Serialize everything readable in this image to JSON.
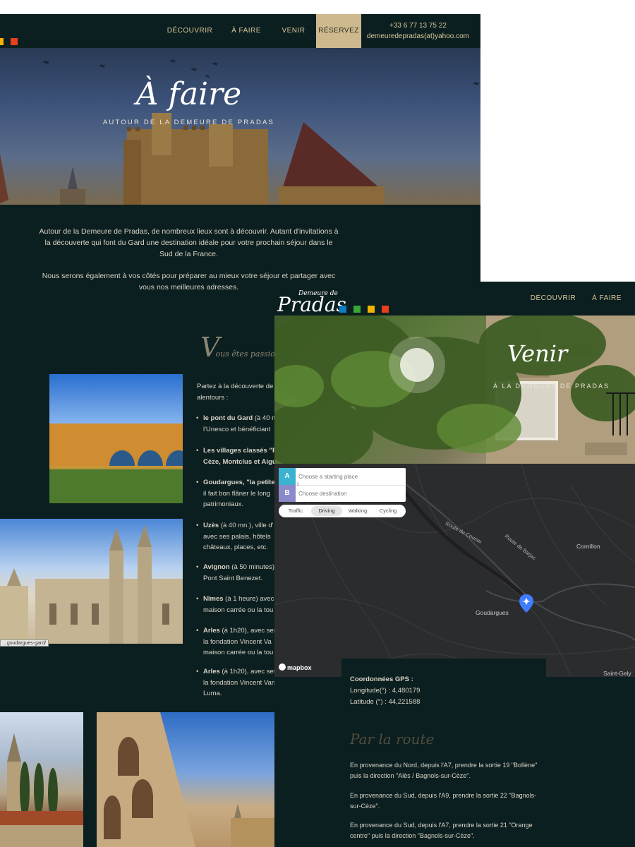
{
  "back_page": {
    "nav": {
      "items": [
        "DÉCOUVRIR",
        "À FAIRE",
        "VENIR",
        "RÉSERVEZ"
      ],
      "phone": "+33 6 77 13 75 22",
      "email": "demeuredepradas(at)yahoo.com"
    },
    "hero": {
      "title": "À faire",
      "subtitle": "AUTOUR DE LA DEMEURE DE PRADAS"
    },
    "intro": {
      "p1": "Autour de la Demeure de Pradas, de nombreux lieux sont à découvrir. Autant d'invitations à la découverte qui font du Gard une destination idéale pour votre prochain séjour dans le Sud de la France.",
      "p2": "Nous serons également à vos côtés pour préparer au mieux votre séjour et partager avec vous nos meilleures adresses."
    },
    "section_heading": {
      "initial": "V",
      "rest": "ous êtes passion"
    },
    "list_intro": "Partez à la découverte de\nalentours :",
    "list": [
      {
        "bold": "le pont du Gard",
        "text": " (à 40 m\nl'Unesco et bénéficiant"
      },
      {
        "bold": "Les villages classés \"Pl\nCèze, Montclus et Aigue",
        "text": ""
      },
      {
        "bold": "Goudargues, \"la petite",
        "text": "\nil fait bon flâner le long\npatrimoniaux."
      },
      {
        "bold": "Uzès",
        "text": " (à 40 mn.), ville d'\navec ses palais, hôtels\nchâteaux, places, etc."
      },
      {
        "bold": "Avignon",
        "text": " (à 50 minutes)\nPont Saint Benezet."
      },
      {
        "bold": "Nîmes",
        "text": " (à 1 heure) avec\nmaison carrée ou la tou"
      },
      {
        "bold": "Arles",
        "text": " (à 1h20), avec ses\nla fondation Vincent Va\nmaison carrée ou la tou"
      },
      {
        "bold": "Arles",
        "text": " (à 1h20), avec ses\nla fondation Vincent Van\nLuma."
      }
    ],
    "tooltip": "...goudargues-gard/",
    "accent_squares": [
      "#f2b200",
      "#e8401c"
    ]
  },
  "front_page": {
    "logo": {
      "small": "Demeure de",
      "big": "Pradas"
    },
    "logo_squares": [
      "#0e7cc2",
      "#35a83a",
      "#f2b200",
      "#e8401c"
    ],
    "nav": {
      "items": [
        "DÉCOUVRIR",
        "À FAIRE"
      ]
    },
    "hero": {
      "title": "Venir",
      "subtitle": "À LA DEMEURE DE PRADAS"
    },
    "map": {
      "start_label": "A",
      "start_placeholder": "Choose a starting place",
      "dest_label": "B",
      "dest_placeholder": "Choose destination",
      "modes": [
        "Traffic",
        "Driving",
        "Walking",
        "Cycling"
      ],
      "active_mode": "Driving",
      "places": {
        "goudargues": "Goudargues",
        "cornillon": "Cornillon",
        "saint_gely": "Saint-Gely"
      },
      "roads": {
        "courau": "Route du Courau",
        "barjac": "Route de Barjac"
      },
      "attribution": "mapbox",
      "badge_a_color": "#3bb2d0",
      "badge_b_color": "#8a8acb",
      "marker_color": "#3f7cff"
    },
    "gps": {
      "title": "Coordonnées GPS :",
      "longitude": "Longitude(°) : 4,480179",
      "latitude": "Latitude (°) : 44,221588"
    },
    "route_heading": "Par la route",
    "route_paragraphs": [
      "En provenance du Nord, depuis l'A7, prendre la sortie 19 \"Bollène\" puis la direction \"Alès / Bagnols-sur-Cèze\".",
      "En provenance du Sud, depuis l'A9, prendre la sortie 22 \"Bagnols-sur-Cèze\".",
      "En provenance du Sud, depuis l'A7, prendre la sortie 21 \"Orange centre\" puis la direction \"Bagnols-sur-Cèze\"."
    ]
  }
}
